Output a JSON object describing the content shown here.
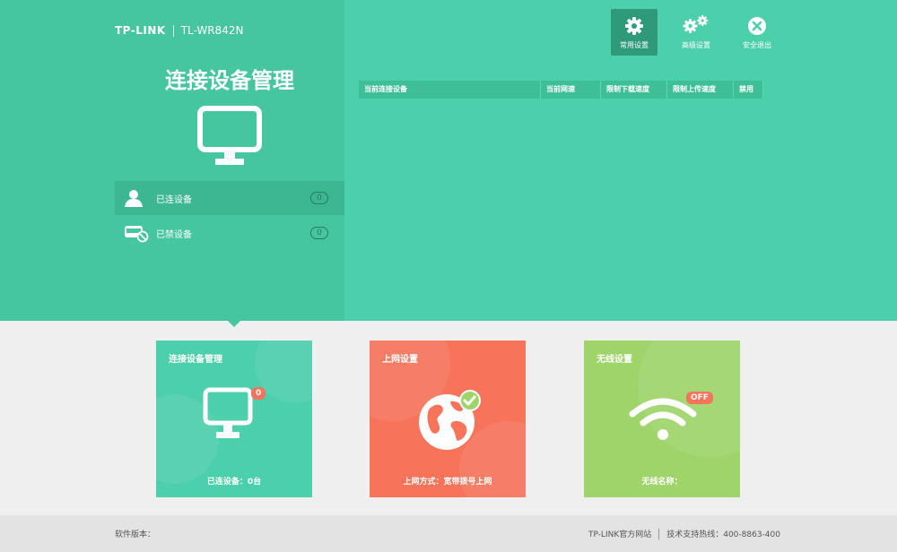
{
  "header": {
    "brand": "TP-LINK",
    "model": "TL-WR842N"
  },
  "sidebar": {
    "title": "连接设备管理",
    "items": [
      {
        "label": "已连设备",
        "count": "0",
        "icon": "user-icon"
      },
      {
        "label": "已禁设备",
        "count": "0",
        "icon": "blocked-device-icon"
      }
    ]
  },
  "topnav": [
    {
      "label": "常用设置",
      "icon": "gear-icon",
      "active": true
    },
    {
      "label": "高级设置",
      "icon": "gears-icon",
      "active": false
    },
    {
      "label": "安全退出",
      "icon": "exit-icon",
      "active": false
    }
  ],
  "table": {
    "columns": [
      "当前连接设备",
      "当前网速",
      "限制下载速度",
      "限制上传速度",
      "禁用"
    ]
  },
  "cards": {
    "devices": {
      "title": "连接设备管理",
      "badge": "0",
      "footer": "已连设备：0台"
    },
    "internet": {
      "title": "上网设置",
      "footer": "上网方式：宽带拨号上网"
    },
    "wireless": {
      "title": "无线设置",
      "badge": "OFF",
      "footer": "无线名称："
    }
  },
  "footer": {
    "firmware_label": "软件版本：",
    "official_site": "TP-LINK官方网站",
    "hotline": "技术支持热线：400-8863-400"
  },
  "colors": {
    "primary": "#4ccfab",
    "sidebar": "#45c6a1",
    "internet_card": "#f7735a",
    "wireless_card": "#9fd46a",
    "badge_red": "#f7735a"
  }
}
